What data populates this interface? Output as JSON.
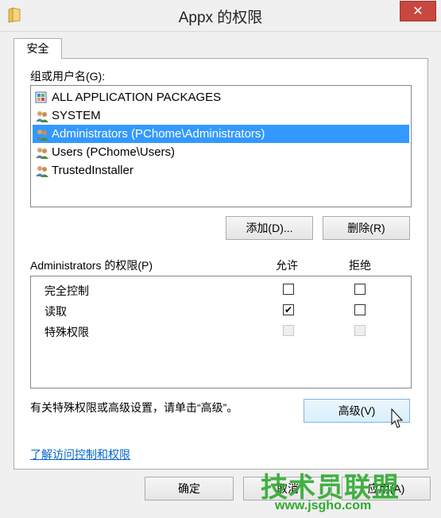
{
  "window": {
    "title": "Appx 的权限",
    "close_glyph": "✕"
  },
  "tab": {
    "label": "安全"
  },
  "groups": {
    "label": "组或用户名(G):",
    "items": [
      {
        "name": "ALL APPLICATION PACKAGES",
        "icon": "package-group-icon"
      },
      {
        "name": "SYSTEM",
        "icon": "users-icon"
      },
      {
        "name": "Administrators (PChome\\Administrators)",
        "icon": "users-icon",
        "selected": true
      },
      {
        "name": "Users (PChome\\Users)",
        "icon": "users-icon"
      },
      {
        "name": "TrustedInstaller",
        "icon": "users-icon"
      }
    ]
  },
  "buttons": {
    "add": "添加(D)...",
    "remove": "删除(R)",
    "advanced": "高级(V)",
    "ok": "确定",
    "cancel": "取消",
    "apply": "应用(A)"
  },
  "permissions": {
    "header": "Administrators 的权限(P)",
    "allow_label": "允许",
    "deny_label": "拒绝",
    "rows": [
      {
        "name": "完全控制",
        "allow": false,
        "deny": false,
        "disabled": false
      },
      {
        "name": "读取",
        "allow": true,
        "deny": false,
        "disabled": false
      },
      {
        "name": "特殊权限",
        "allow": false,
        "deny": false,
        "disabled": true
      }
    ],
    "check_glyph": "✔"
  },
  "advanced_hint": "有关特殊权限或高级设置，请单击“高级”。",
  "help_link": "了解访问控制和权限",
  "watermark": {
    "text": "技术员联盟",
    "url": "www.jsgho.com"
  }
}
